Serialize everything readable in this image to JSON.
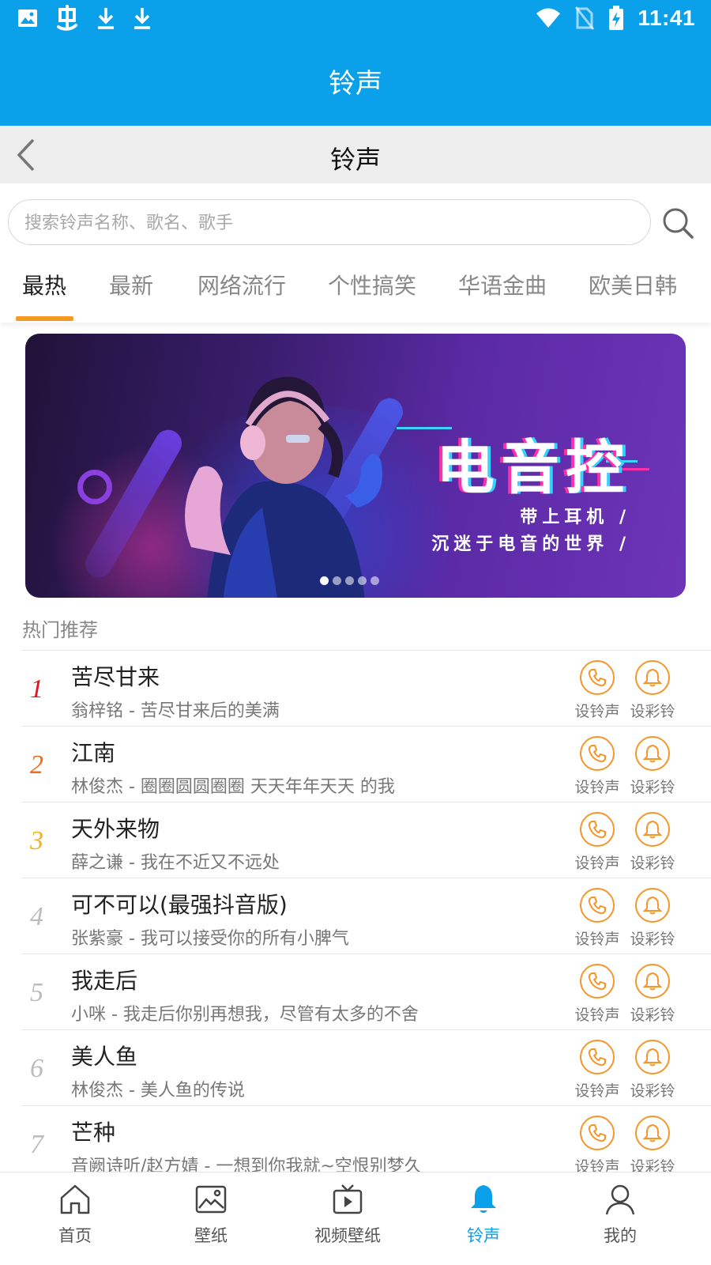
{
  "status_bar": {
    "time": "11:41",
    "left_icons": [
      "image-icon",
      "app-logo-icon",
      "download-icon",
      "download-icon"
    ],
    "right_icons": [
      "wifi-icon",
      "no-sim-icon",
      "battery-charging-icon"
    ]
  },
  "app_bar": {
    "title": "铃声"
  },
  "sub_header": {
    "title": "铃声"
  },
  "search": {
    "placeholder": "搜索铃声名称、歌名、歌手",
    "value": ""
  },
  "tabs": [
    {
      "label": "最热",
      "active": true
    },
    {
      "label": "最新",
      "active": false
    },
    {
      "label": "网络流行",
      "active": false
    },
    {
      "label": "个性搞笑",
      "active": false
    },
    {
      "label": "华语金曲",
      "active": false
    },
    {
      "label": "欧美日韩",
      "active": false
    }
  ],
  "banner": {
    "headline": "电音控",
    "line1": "带上耳机 /",
    "line2": "沉迷于电音的世界 /",
    "slide_count": 5,
    "active_slide": 1
  },
  "section": {
    "title": "热门推荐"
  },
  "actions": {
    "set_ringtone": "设铃声",
    "set_color_ring": "设彩铃"
  },
  "songs": [
    {
      "rank": "1",
      "title": "苦尽甘来",
      "subtitle": "翁梓铭 - 苦尽甘来后的美满"
    },
    {
      "rank": "2",
      "title": "江南",
      "subtitle": "林俊杰 - 圈圈圆圆圈圈 天天年年天天 的我"
    },
    {
      "rank": "3",
      "title": "天外来物",
      "subtitle": "薛之谦 - 我在不近又不远处"
    },
    {
      "rank": "4",
      "title": "可不可以(最强抖音版)",
      "subtitle": "张紫豪 - 我可以接受你的所有小脾气"
    },
    {
      "rank": "5",
      "title": "我走后",
      "subtitle": "小咪 - 我走后你别再想我，尽管有太多的不舍"
    },
    {
      "rank": "6",
      "title": "美人鱼",
      "subtitle": "林俊杰 - 美人鱼的传说"
    },
    {
      "rank": "7",
      "title": "芒种",
      "subtitle": "音阙诗听/赵方婧 - 一想到你我就~空恨别梦久"
    }
  ],
  "bottom_nav": [
    {
      "label": "首页",
      "icon": "home-icon",
      "active": false
    },
    {
      "label": "壁纸",
      "icon": "wallpaper-icon",
      "active": false
    },
    {
      "label": "视频壁纸",
      "icon": "video-wallpaper-icon",
      "active": false
    },
    {
      "label": "铃声",
      "icon": "bell-icon",
      "active": true
    },
    {
      "label": "我的",
      "icon": "profile-icon",
      "active": false
    }
  ],
  "colors": {
    "primary": "#0aa0ea",
    "accent": "#f5952a",
    "tab_indicator": "#f59a23",
    "rank1": "#e8141b",
    "rank2": "#f06a1a",
    "rank3": "#f5b324"
  }
}
